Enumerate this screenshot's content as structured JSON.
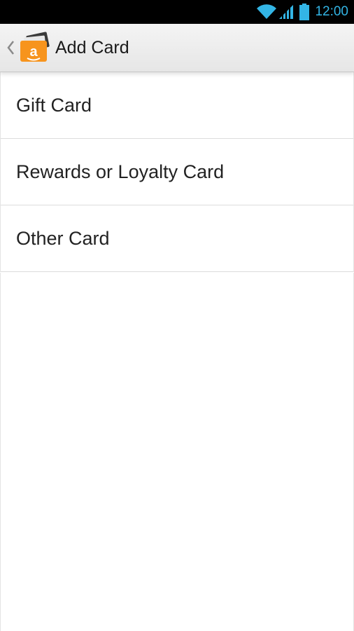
{
  "status_bar": {
    "time": "12:00",
    "icons": [
      "wifi-icon",
      "signal-icon",
      "battery-icon"
    ],
    "accent": "#33b5e5"
  },
  "action_bar": {
    "title": "Add Card",
    "logo_letter": "a",
    "icons": [
      "back-chevron-icon",
      "amazon-wallet-logo"
    ]
  },
  "menu": {
    "items": [
      {
        "label": "Gift Card"
      },
      {
        "label": "Rewards or Loyalty Card"
      },
      {
        "label": "Other Card"
      }
    ]
  },
  "colors": {
    "logo_orange": "#f7941d",
    "status_bar_bg": "#000000",
    "action_bar_bg": "#eeeeee"
  }
}
